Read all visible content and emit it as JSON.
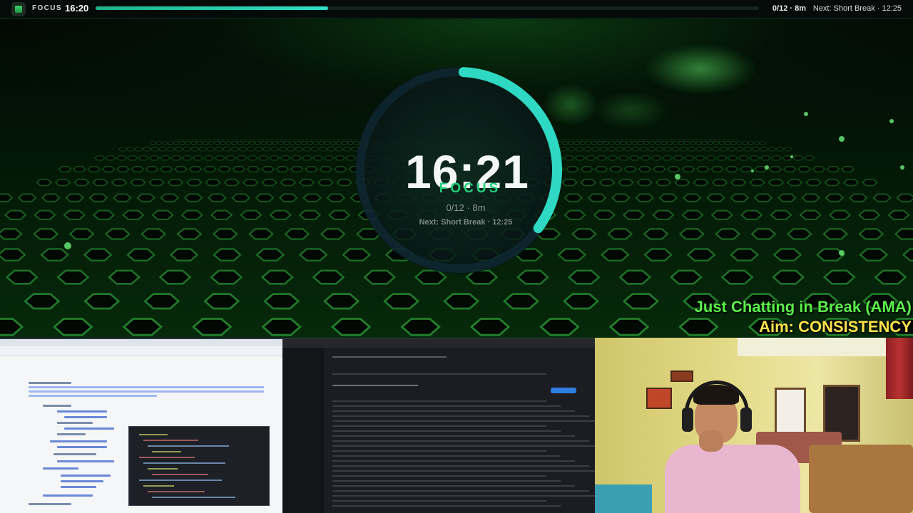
{
  "topbar": {
    "mode": "FOCUS",
    "time": "16:20",
    "progress": 0.35,
    "count": "0/12 · 8m",
    "next": "Next: Short Break · 12:25",
    "icon": "app-logo-icon"
  },
  "timer": {
    "time": "16:21",
    "phase": "FOCUS",
    "cycle": "0/12 · 8m",
    "next": "Next: Short Break · 12:25",
    "ring_progress": 0.35,
    "ring_color": "#2fd8c2",
    "phase_color": "#21d07a"
  },
  "overlay": {
    "line1": "Just Chatting in Break (AMA)",
    "line2": "Aim: CONSISTENCY",
    "line1_color": "#5af04a",
    "line2_color": "#ffe34a"
  },
  "panels": {
    "left_screen": "browser-with-code-editor",
    "mid_screen": "dark-mail-client",
    "webcam": "streamer-webcam"
  }
}
